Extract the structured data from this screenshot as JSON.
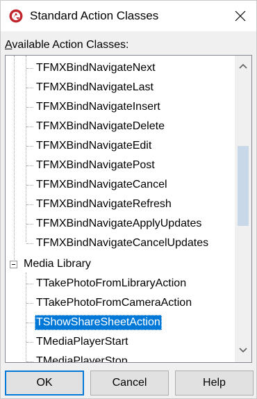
{
  "window": {
    "title": "Standard Action Classes"
  },
  "caption": {
    "underlined": "A",
    "rest": "vailable Action Classes:"
  },
  "tree": {
    "bind_items": [
      "TFMXBindNavigateNext",
      "TFMXBindNavigateLast",
      "TFMXBindNavigateInsert",
      "TFMXBindNavigateDelete",
      "TFMXBindNavigateEdit",
      "TFMXBindNavigatePost",
      "TFMXBindNavigateCancel",
      "TFMXBindNavigateRefresh",
      "TFMXBindNavigateApplyUpdates",
      "TFMXBindNavigateCancelUpdates"
    ],
    "category": {
      "label": "Media Library",
      "expanded": true
    },
    "media_items": [
      "TTakePhotoFromLibraryAction",
      "TTakePhotoFromCameraAction",
      "TShowShareSheetAction",
      "TMediaPlayerStart",
      "TMediaPlayerStop"
    ],
    "selected_item": "TShowShareSheetAction"
  },
  "buttons": {
    "ok": "OK",
    "cancel": "Cancel",
    "help": "Help"
  },
  "colors": {
    "selection": "#0078d7",
    "ok_border": "#0078d7",
    "app_icon": "#c0272d"
  }
}
